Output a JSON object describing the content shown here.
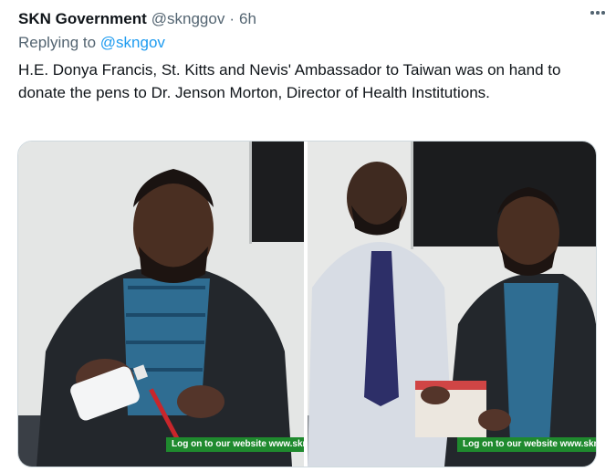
{
  "tweet": {
    "author_name": "SKN Government",
    "handle": "@sknggov",
    "separator": "·",
    "time": "6h",
    "replying_prefix": "Replying to ",
    "replying_to": "@skngov",
    "text": "H.E. Donya Francis, St. Kitts and Nevis' Ambassador to Taiwan was on hand to donate the pens to Dr. Jenson Morton, Director of Health Institutions."
  },
  "media": {
    "photo_left": {
      "banner_text": "Log on to our website www.skn"
    },
    "photo_right": {
      "banner_text": "Log on to our website www.skn"
    }
  },
  "colors": {
    "link": "#1d9bf0",
    "secondary_text": "#536471",
    "banner_green": "#1f8a2e"
  },
  "icons": {
    "more": "more-horizontal-icon"
  }
}
